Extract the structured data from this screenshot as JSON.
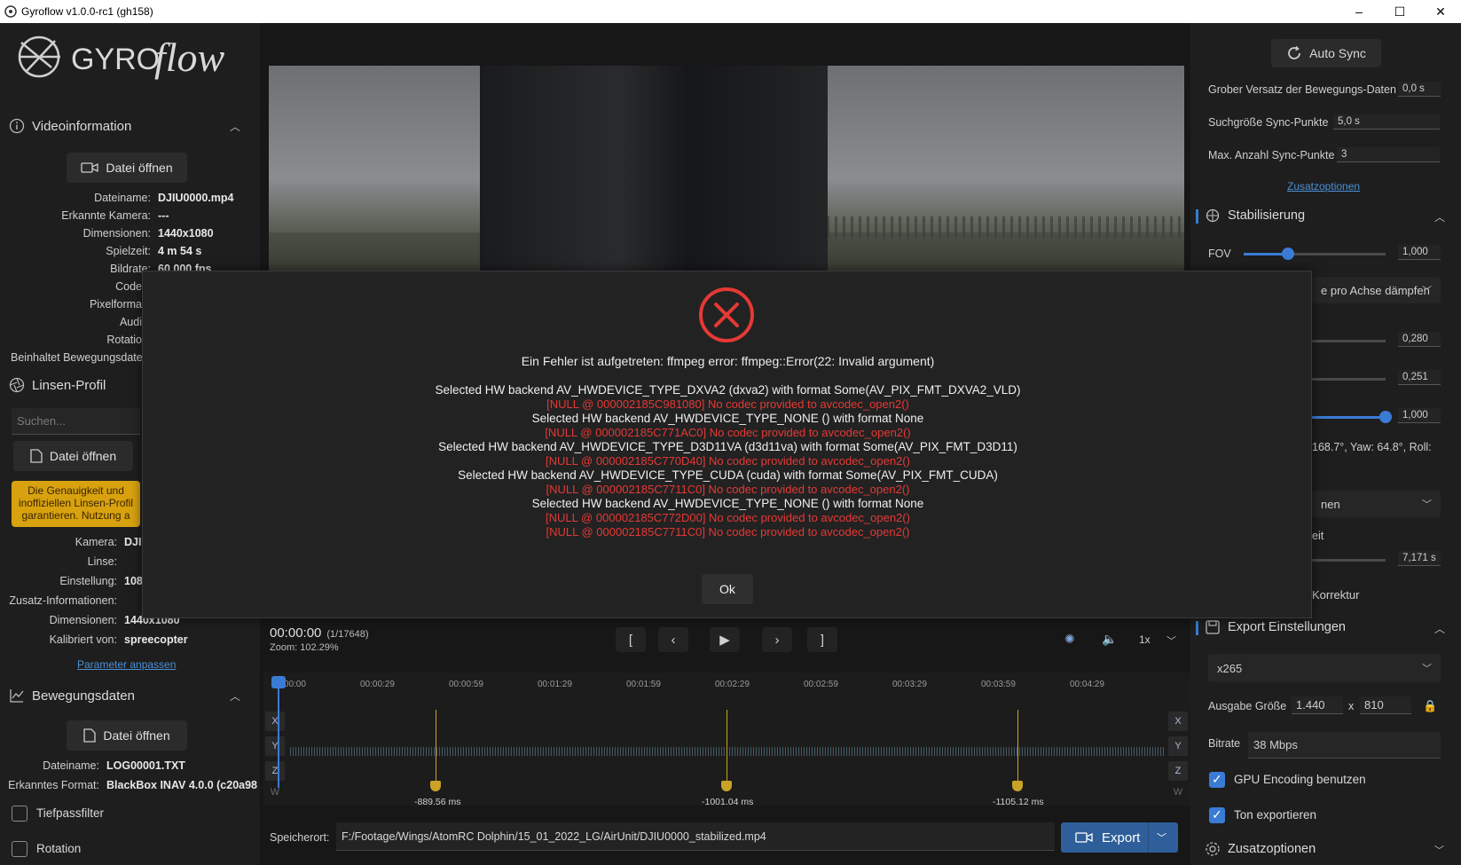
{
  "window": {
    "title": "Gyroflow v1.0.0-rc1 (gh158)",
    "controls": [
      "–",
      "☐",
      "✕"
    ]
  },
  "left": {
    "logo_text": "GYRO",
    "logo_script": "flow",
    "video_info": {
      "header": "Videoinformation",
      "open_button": "Datei öffnen",
      "rows": [
        {
          "k": "Dateiname:",
          "v": "DJIU0000.mp4"
        },
        {
          "k": "Erkannte Kamera:",
          "v": "---"
        },
        {
          "k": "Dimensionen:",
          "v": "1440x1080"
        },
        {
          "k": "Spielzeit:",
          "v": "4 m 54 s"
        },
        {
          "k": "Bildrate:",
          "v": "60.000 fps"
        }
      ],
      "partial_keys": [
        "Code",
        "Pixelforma",
        "Audi",
        "Rotatio",
        "Beinhaltet Bewegungsdate"
      ]
    },
    "lens": {
      "header": "Linsen-Profil",
      "search_placeholder": "Suchen...",
      "open_button": "Datei öffnen",
      "warning": "Die Genauigkeit und\ninoffiziellen Linsen-Profil\ngarantieren. Nutzung a",
      "rows": [
        {
          "k": "Kamera:",
          "v": "DJI"
        },
        {
          "k": "Linse:",
          "v": ""
        },
        {
          "k": "Einstellung:",
          "v": "108"
        },
        {
          "k": "Zusatz-Informationen:",
          "v": ""
        },
        {
          "k": "Dimensionen:",
          "v": "1440x1080"
        },
        {
          "k": "Kalibriert von:",
          "v": "spreecopter"
        }
      ],
      "adjust_link": "Parameter anpassen"
    },
    "motion": {
      "header": "Bewegungsdaten",
      "open_button": "Datei öffnen",
      "rows": [
        {
          "k": "Dateiname:",
          "v": "LOG00001.TXT"
        },
        {
          "k": "Erkanntes Format:",
          "v": "BlackBox INAV 4.0.0 (c20a98"
        }
      ],
      "lowpass": "Tiefpassfilter",
      "rotation": "Rotation"
    }
  },
  "center": {
    "timecode": "00:00:00",
    "frames": "(1/17648)",
    "zoom": "Zoom: 102.29%",
    "transport": [
      "[",
      "‹",
      "▶",
      "›",
      "]"
    ],
    "speed": "1x",
    "ticks": [
      "00:00:00",
      "00:00:29",
      "00:00:59",
      "00:01:29",
      "00:01:59",
      "00:02:29",
      "00:02:59",
      "00:03:29",
      "00:03:59",
      "00:04:29"
    ],
    "axes": [
      "X",
      "Y",
      "Z",
      "W"
    ],
    "sync_points": [
      "-889.56 ms",
      "-1001.04 ms",
      "-1105.12 ms"
    ],
    "save_label": "Speicherort:",
    "save_path": "F:/Footage/Wings/AtomRC Dolphin/15_01_2022_LG/AirUnit/DJIU0000_stabilized.mp4",
    "export_button": "Export"
  },
  "right": {
    "auto_sync": "Auto Sync",
    "sync_rows": [
      {
        "label": "Grober Versatz der Bewegungs-Daten",
        "value": "0,0 s"
      },
      {
        "label": "Suchgröße Sync-Punkte",
        "value": "5,0 s"
      },
      {
        "label": "Max. Anzahl Sync-Punkte",
        "value": "3"
      }
    ],
    "more_options_link": "Zusatzoptionen",
    "stab_header": "Stabilisierung",
    "fov_label": "FOV",
    "fov_value": "1,000",
    "smoothing_select": "e pro Achse dämpfen",
    "slider_values": [
      "0,280",
      "0,251",
      "1,000"
    ],
    "angles": "168.7°, Yaw: 64.8°, Roll:",
    "partial_select": "nen",
    "partial_label": "eit",
    "horizon_value": "7,171 s",
    "correction_label": "Korrektur",
    "export_header": "Export Einstellungen",
    "codec": "x265",
    "output_size_label": "Ausgabe Größe",
    "width": "1.440",
    "height": "810",
    "x_sep": "x",
    "bitrate_label": "Bitrate",
    "bitrate": "38 Mbps",
    "gpu_label": "GPU Encoding benutzen",
    "audio_label": "Ton exportieren",
    "extra_header": "Zusatzoptionen"
  },
  "dialog": {
    "title": "Ein Fehler ist aufgetreten: ffmpeg error: ffmpeg::Error(22: Invalid argument)",
    "lines": [
      {
        "t": "Selected HW backend AV_HWDEVICE_TYPE_DXVA2 (dxva2) with format Some(AV_PIX_FMT_DXVA2_VLD)",
        "c": "white"
      },
      {
        "t": "[NULL @ 000002185C981080] No codec provided to avcodec_open2()",
        "c": "red"
      },
      {
        "t": "Selected HW backend AV_HWDEVICE_TYPE_NONE () with format None",
        "c": "white"
      },
      {
        "t": "[NULL @ 000002185C771AC0] No codec provided to avcodec_open2()",
        "c": "red"
      },
      {
        "t": "Selected HW backend AV_HWDEVICE_TYPE_D3D11VA (d3d11va) with format Some(AV_PIX_FMT_D3D11)",
        "c": "white"
      },
      {
        "t": "[NULL @ 000002185C770D40] No codec provided to avcodec_open2()",
        "c": "red"
      },
      {
        "t": "Selected HW backend AV_HWDEVICE_TYPE_CUDA (cuda) with format Some(AV_PIX_FMT_CUDA)",
        "c": "white"
      },
      {
        "t": "[NULL @ 000002185C7711C0] No codec provided to avcodec_open2()",
        "c": "red"
      },
      {
        "t": "Selected HW backend AV_HWDEVICE_TYPE_NONE () with format None",
        "c": "white"
      },
      {
        "t": "[NULL @ 000002185C772D00] No codec provided to avcodec_open2()",
        "c": "red"
      },
      {
        "t": "[NULL @ 000002185C7711C0] No codec provided to avcodec_open2()",
        "c": "red"
      }
    ],
    "ok": "Ok"
  },
  "colors": {
    "accent": "#3a7bd5",
    "error": "#e53935",
    "warning": "#d8a20f",
    "sync": "#c9a227"
  }
}
